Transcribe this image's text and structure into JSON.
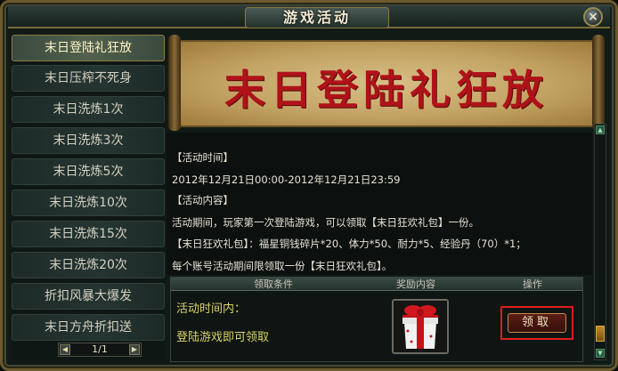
{
  "window": {
    "title": "游戏活动",
    "close_label": "×"
  },
  "sidebar": {
    "items": [
      {
        "label": "末日登陆礼狂放",
        "active": true
      },
      {
        "label": "末日压榨不死身"
      },
      {
        "label": "末日洗炼1次"
      },
      {
        "label": "末日洗炼3次"
      },
      {
        "label": "末日洗炼5次"
      },
      {
        "label": "末日洗炼10次"
      },
      {
        "label": "末日洗炼15次"
      },
      {
        "label": "末日洗炼20次"
      },
      {
        "label": "折扣风暴大爆发"
      },
      {
        "label": "末日方舟折扣送"
      }
    ],
    "pager": {
      "text": "1/1",
      "prev": "◀",
      "next": "▶"
    }
  },
  "banner": {
    "title": "末日登陆礼狂放"
  },
  "content": {
    "time_header": "【活动时间】",
    "time_range": "2012年12月21日00:00-2012年12月21日23:59",
    "content_header": "【活动内容】",
    "content_desc": "活动期间，玩家第一次登陆游戏，可以领取【末日狂欢礼包】一份。",
    "package_desc": "【末日狂欢礼包】：福星铜钱碎片*20、体力*50、耐力*5、经验丹（70）*1；",
    "limit_desc": "每个账号活动期间限领取一份【末日狂欢礼包】。"
  },
  "table": {
    "headers": [
      "领取条件",
      "奖励内容",
      "操作"
    ],
    "condition_time": "活动时间内：",
    "condition_req": "登陆游戏即可领取",
    "reward_icon": "red-gift-box-icon",
    "claim_label": "领取"
  },
  "scrollbar": {
    "up": "▲",
    "down": "▼"
  },
  "colors": {
    "banner_text": "#b0121a",
    "condition_text": "#d8d36a",
    "highlight_frame": "#e01c1c",
    "active_item_text": "#fff4c8"
  }
}
